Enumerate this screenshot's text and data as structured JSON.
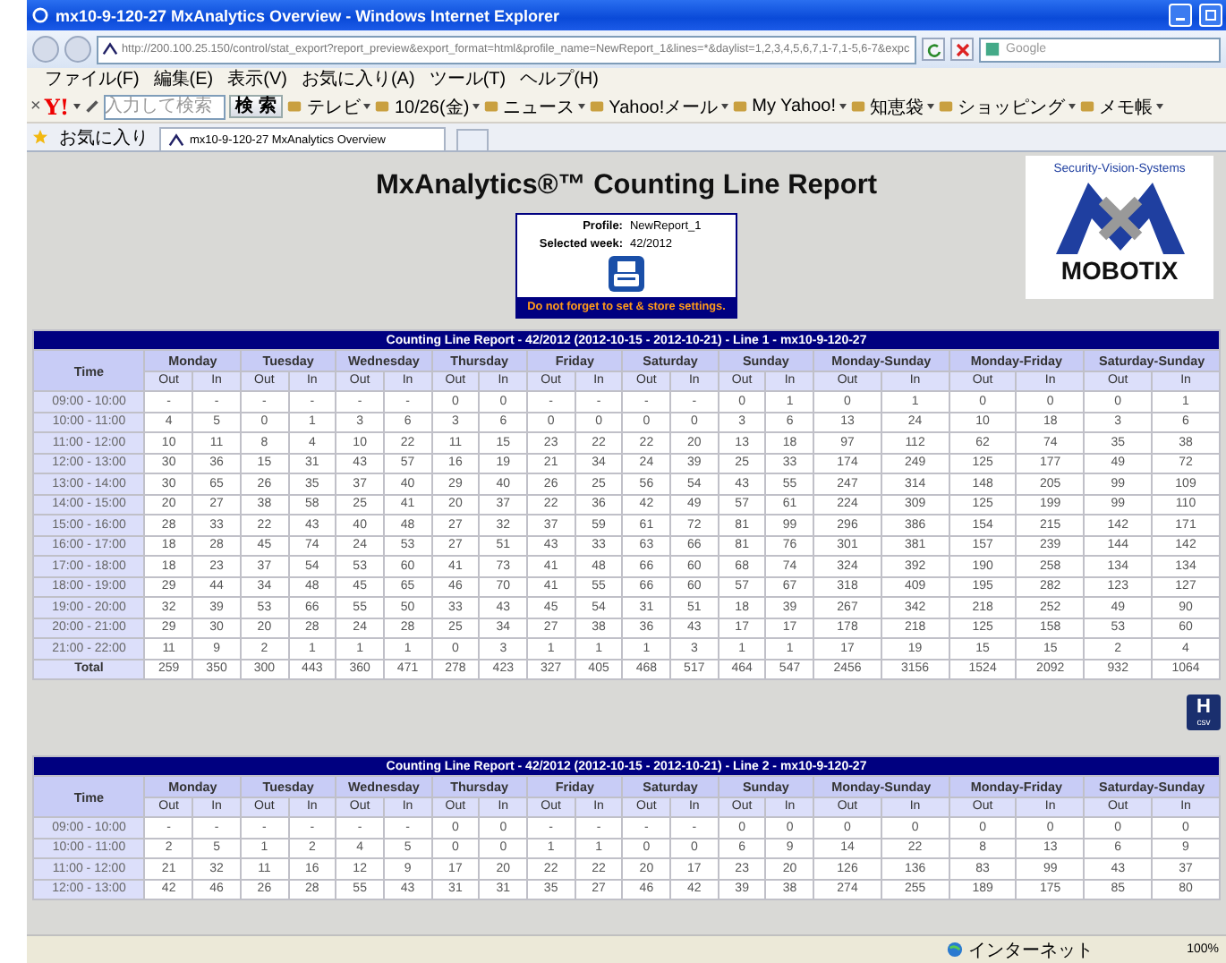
{
  "window": {
    "title": "mx10-9-120-27 MxAnalytics Overview - Windows Internet Explorer"
  },
  "address_bar": {
    "url": "http://200.100.25.150/control/stat_export?report_preview&export_format=html&profile_name=NewReport_1&lines=*&daylist=1,2,3,4,5,6,7,1-7,1-5,6-7&expc",
    "search_placeholder": "Google"
  },
  "menu": [
    "ファイル(F)",
    "編集(E)",
    "表示(V)",
    "お気に入り(A)",
    "ツール(T)",
    "ヘルプ(H)"
  ],
  "toolbar": {
    "close": "×",
    "logo": "Y!",
    "search_placeholder": "入力して検索",
    "search_button": "検 索",
    "items": [
      "テレビ",
      "10/26(金)",
      "ニュース",
      "Yahoo!メール",
      "My Yahoo!",
      "知恵袋",
      "ショッピング",
      "メモ帳"
    ]
  },
  "favorites": {
    "label": "お気に入り",
    "tabs": [
      {
        "label": "mx10-9-120-27 MxAnalytics Overview",
        "selected": true
      }
    ]
  },
  "page": {
    "title": "MxAnalytics®™ Counting Line Report",
    "profile": [
      {
        "label": "Profile:",
        "value": "NewReport_1"
      },
      {
        "label": "Selected week:",
        "value": "42/2012"
      }
    ],
    "notice": "Do not forget to set & store settings.",
    "logo": {
      "tagline": "Security-Vision-Systems",
      "brand": "MOBOTIX"
    },
    "csv_icon": {
      "letter": "H",
      "caption": "csv"
    },
    "reports": [
      {
        "title": "Counting Line Report - 42/2012 (2012-10-15 - 2012-10-21) - Line 1 - mx10-9-120-27",
        "time_header": "Time",
        "groups": [
          {
            "label": "Monday",
            "kind": "day",
            "columns": [
              "Out",
              "In"
            ]
          },
          {
            "label": "Tuesday",
            "kind": "day",
            "columns": [
              "Out",
              "In"
            ]
          },
          {
            "label": "Wednesday",
            "kind": "day",
            "columns": [
              "Out",
              "In"
            ]
          },
          {
            "label": "Thursday",
            "kind": "day",
            "columns": [
              "Out",
              "In"
            ]
          },
          {
            "label": "Friday",
            "kind": "day",
            "columns": [
              "Out",
              "In"
            ]
          },
          {
            "label": "Saturday",
            "kind": "day",
            "columns": [
              "Out",
              "In"
            ]
          },
          {
            "label": "Sunday",
            "kind": "day",
            "columns": [
              "Out",
              "In"
            ]
          },
          {
            "label": "Monday-Sunday",
            "kind": "sum",
            "columns": [
              "Out",
              "In"
            ]
          },
          {
            "label": "Monday-Friday",
            "kind": "sum",
            "columns": [
              "Out",
              "In"
            ]
          },
          {
            "label": "Saturday-Sunday",
            "kind": "sum",
            "columns": [
              "Out",
              "In"
            ]
          }
        ],
        "rows": [
          {
            "kind": "hour",
            "time": "09:00 - 10:00",
            "values": [
              "-",
              "-",
              "-",
              "-",
              "-",
              "-",
              "0",
              "0",
              "-",
              "-",
              "-",
              "-",
              "0",
              "1",
              "0",
              "1",
              "0",
              "0",
              "0",
              "1"
            ]
          },
          {
            "kind": "hour",
            "time": "10:00 - 11:00",
            "values": [
              "4",
              "5",
              "0",
              "1",
              "3",
              "6",
              "3",
              "6",
              "0",
              "0",
              "0",
              "0",
              "3",
              "6",
              "13",
              "24",
              "10",
              "18",
              "3",
              "6"
            ]
          },
          {
            "kind": "hour",
            "time": "11:00 - 12:00",
            "values": [
              "10",
              "11",
              "8",
              "4",
              "10",
              "22",
              "11",
              "15",
              "23",
              "22",
              "22",
              "20",
              "13",
              "18",
              "97",
              "112",
              "62",
              "74",
              "35",
              "38"
            ]
          },
          {
            "kind": "hour",
            "time": "12:00 - 13:00",
            "values": [
              "30",
              "36",
              "15",
              "31",
              "43",
              "57",
              "16",
              "19",
              "21",
              "34",
              "24",
              "39",
              "25",
              "33",
              "174",
              "249",
              "125",
              "177",
              "49",
              "72"
            ]
          },
          {
            "kind": "hour",
            "time": "13:00 - 14:00",
            "values": [
              "30",
              "65",
              "26",
              "35",
              "37",
              "40",
              "29",
              "40",
              "26",
              "25",
              "56",
              "54",
              "43",
              "55",
              "247",
              "314",
              "148",
              "205",
              "99",
              "109"
            ]
          },
          {
            "kind": "hour",
            "time": "14:00 - 15:00",
            "values": [
              "20",
              "27",
              "38",
              "58",
              "25",
              "41",
              "20",
              "37",
              "22",
              "36",
              "42",
              "49",
              "57",
              "61",
              "224",
              "309",
              "125",
              "199",
              "99",
              "110"
            ]
          },
          {
            "kind": "hour",
            "time": "15:00 - 16:00",
            "values": [
              "28",
              "33",
              "22",
              "43",
              "40",
              "48",
              "27",
              "32",
              "37",
              "59",
              "61",
              "72",
              "81",
              "99",
              "296",
              "386",
              "154",
              "215",
              "142",
              "171"
            ]
          },
          {
            "kind": "hour",
            "time": "16:00 - 17:00",
            "values": [
              "18",
              "28",
              "45",
              "74",
              "24",
              "53",
              "27",
              "51",
              "43",
              "33",
              "63",
              "66",
              "81",
              "76",
              "301",
              "381",
              "157",
              "239",
              "144",
              "142"
            ]
          },
          {
            "kind": "hour",
            "time": "17:00 - 18:00",
            "values": [
              "18",
              "23",
              "37",
              "54",
              "53",
              "60",
              "41",
              "73",
              "41",
              "48",
              "66",
              "60",
              "68",
              "74",
              "324",
              "392",
              "190",
              "258",
              "134",
              "134"
            ]
          },
          {
            "kind": "hour",
            "time": "18:00 - 19:00",
            "values": [
              "29",
              "44",
              "34",
              "48",
              "45",
              "65",
              "46",
              "70",
              "41",
              "55",
              "66",
              "60",
              "57",
              "67",
              "318",
              "409",
              "195",
              "282",
              "123",
              "127"
            ]
          },
          {
            "kind": "hour",
            "time": "19:00 - 20:00",
            "values": [
              "32",
              "39",
              "53",
              "66",
              "55",
              "50",
              "33",
              "43",
              "45",
              "54",
              "31",
              "51",
              "18",
              "39",
              "267",
              "342",
              "218",
              "252",
              "49",
              "90"
            ]
          },
          {
            "kind": "hour",
            "time": "20:00 - 21:00",
            "values": [
              "29",
              "30",
              "20",
              "28",
              "24",
              "28",
              "25",
              "34",
              "27",
              "38",
              "36",
              "43",
              "17",
              "17",
              "178",
              "218",
              "125",
              "158",
              "53",
              "60"
            ]
          },
          {
            "kind": "hour",
            "time": "21:00 - 22:00",
            "values": [
              "11",
              "9",
              "2",
              "1",
              "1",
              "1",
              "0",
              "3",
              "1",
              "1",
              "1",
              "3",
              "1",
              "1",
              "17",
              "19",
              "15",
              "15",
              "2",
              "4"
            ]
          },
          {
            "kind": "total",
            "time": "Total",
            "values": [
              "259",
              "350",
              "300",
              "443",
              "360",
              "471",
              "278",
              "423",
              "327",
              "405",
              "468",
              "517",
              "464",
              "547",
              "2456",
              "3156",
              "1524",
              "2092",
              "932",
              "1064"
            ]
          }
        ]
      },
      {
        "title": "Counting Line Report - 42/2012 (2012-10-15 - 2012-10-21) - Line 2 - mx10-9-120-27",
        "time_header": "Time",
        "groups": [
          {
            "label": "Monday",
            "kind": "day",
            "columns": [
              "Out",
              "In"
            ]
          },
          {
            "label": "Tuesday",
            "kind": "day",
            "columns": [
              "Out",
              "In"
            ]
          },
          {
            "label": "Wednesday",
            "kind": "day",
            "columns": [
              "Out",
              "In"
            ]
          },
          {
            "label": "Thursday",
            "kind": "day",
            "columns": [
              "Out",
              "In"
            ]
          },
          {
            "label": "Friday",
            "kind": "day",
            "columns": [
              "Out",
              "In"
            ]
          },
          {
            "label": "Saturday",
            "kind": "day",
            "columns": [
              "Out",
              "In"
            ]
          },
          {
            "label": "Sunday",
            "kind": "day",
            "columns": [
              "Out",
              "In"
            ]
          },
          {
            "label": "Monday-Sunday",
            "kind": "sum",
            "columns": [
              "Out",
              "In"
            ]
          },
          {
            "label": "Monday-Friday",
            "kind": "sum",
            "columns": [
              "Out",
              "In"
            ]
          },
          {
            "label": "Saturday-Sunday",
            "kind": "sum",
            "columns": [
              "Out",
              "In"
            ]
          }
        ],
        "rows": [
          {
            "kind": "hour",
            "time": "09:00 - 10:00",
            "values": [
              "-",
              "-",
              "-",
              "-",
              "-",
              "-",
              "0",
              "0",
              "-",
              "-",
              "-",
              "-",
              "0",
              "0",
              "0",
              "0",
              "0",
              "0",
              "0",
              "0"
            ]
          },
          {
            "kind": "hour",
            "time": "10:00 - 11:00",
            "values": [
              "2",
              "5",
              "1",
              "2",
              "4",
              "5",
              "0",
              "0",
              "1",
              "1",
              "0",
              "0",
              "6",
              "9",
              "14",
              "22",
              "8",
              "13",
              "6",
              "9"
            ]
          },
          {
            "kind": "hour",
            "time": "11:00 - 12:00",
            "values": [
              "21",
              "32",
              "11",
              "16",
              "12",
              "9",
              "17",
              "20",
              "22",
              "22",
              "20",
              "17",
              "23",
              "20",
              "126",
              "136",
              "83",
              "99",
              "43",
              "37"
            ]
          },
          {
            "kind": "hour",
            "time": "12:00 - 13:00",
            "values": [
              "42",
              "46",
              "26",
              "28",
              "55",
              "43",
              "31",
              "31",
              "35",
              "27",
              "46",
              "42",
              "39",
              "38",
              "274",
              "255",
              "189",
              "175",
              "85",
              "80"
            ]
          }
        ]
      }
    ]
  },
  "status_bar": {
    "zone": "インターネット",
    "zoom": "100%"
  }
}
